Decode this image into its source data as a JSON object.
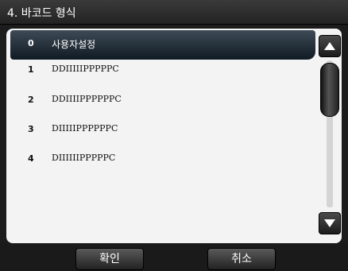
{
  "window": {
    "title": "4. 바코드 형식"
  },
  "list": {
    "items": [
      {
        "index": "0",
        "label": "사용자설정",
        "selected": true
      },
      {
        "index": "1",
        "label": "DDIIIIIPPPPPC",
        "selected": false
      },
      {
        "index": "2",
        "label": "DDIIIIPPPPPPC",
        "selected": false
      },
      {
        "index": "3",
        "label": "DIIIIIPPPPPPC",
        "selected": false
      },
      {
        "index": "4",
        "label": "DIIIIIIPPPPPC",
        "selected": false
      }
    ]
  },
  "scrollbar": {
    "up_icon": "triangle-up-icon",
    "down_icon": "triangle-down-icon"
  },
  "footer": {
    "ok_label": "확인",
    "cancel_label": "취소"
  }
}
